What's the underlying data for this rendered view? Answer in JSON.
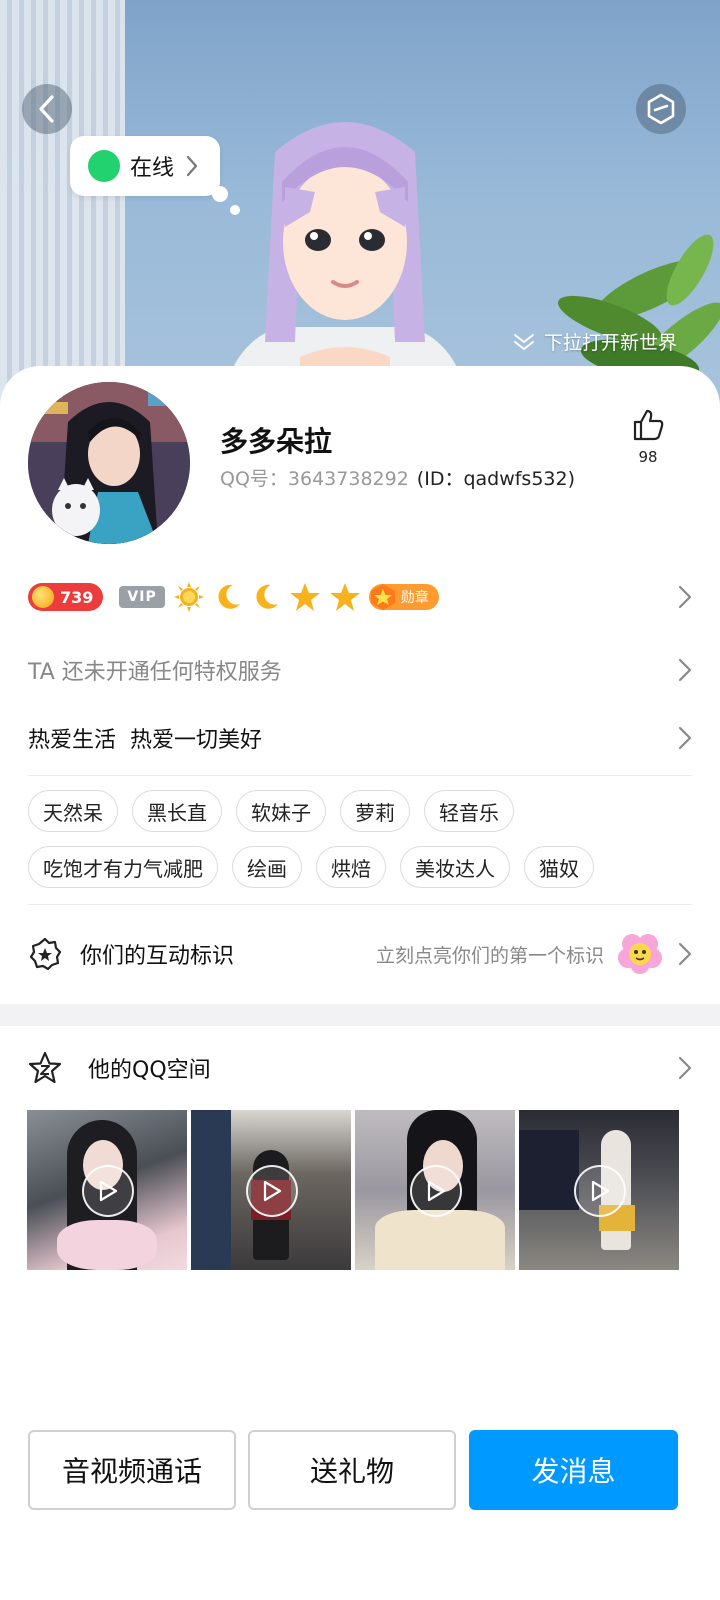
{
  "hero": {
    "status_label": "在线",
    "pull_hint": "下拉打开新世界"
  },
  "profile": {
    "nickname": "多多朵拉",
    "qq_label": "QQ号：3643738292",
    "id_label": "(ID：qadwfs532)",
    "likes": "98"
  },
  "badges": {
    "level": "739",
    "vip": "VIP",
    "medal": "勋章"
  },
  "privilege_text": "TA 还未开通任何特权服务",
  "signature": "热爱生活  热爱一切美好",
  "tags": [
    "天然呆",
    "黑长直",
    "软妹子",
    "萝莉",
    "轻音乐",
    "吃饱才有力气减肥",
    "绘画",
    "烘焙",
    "美妆达人",
    "猫奴"
  ],
  "interaction": {
    "title": "你们的互动标识",
    "subtitle": "立刻点亮你们的第一个标识"
  },
  "qzone": {
    "title": "他的QQ空间"
  },
  "actions": {
    "call": "音视频通话",
    "gift": "送礼物",
    "message": "发消息"
  },
  "colors": {
    "primary": "#0099ff",
    "online": "#21d26e",
    "level": "#ec3c3c",
    "medal": "#ff9b2f"
  }
}
